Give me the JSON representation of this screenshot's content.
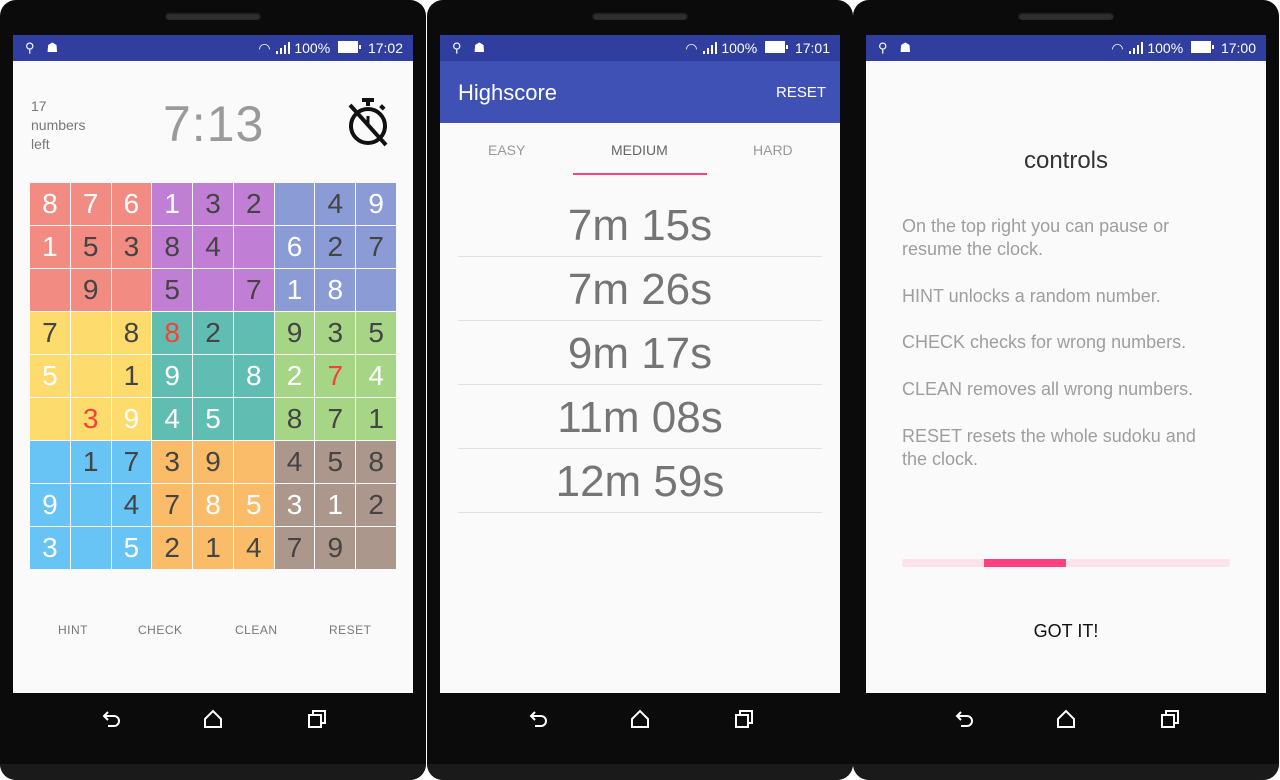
{
  "status_bars": [
    {
      "battery": "100%",
      "time": "17:02"
    },
    {
      "battery": "100%",
      "time": "17:01"
    },
    {
      "battery": "100%",
      "time": "17:00"
    }
  ],
  "game": {
    "numbers_left": "17",
    "numbers_left_line2": "numbers",
    "numbers_left_line3": "left",
    "timer": "7:13",
    "actions": {
      "hint": "HINT",
      "check": "CHECK",
      "clean": "CLEAN",
      "reset": "RESET"
    },
    "box_colors": [
      "#f28b82",
      "#c07fd4",
      "#8b9bd6",
      "#fddb6d",
      "#5fbdb1",
      "#a6d685",
      "#67c4f4",
      "#fbbc6a",
      "#ab978c"
    ],
    "error_color": "#f44336",
    "grid": [
      [
        "8",
        "7",
        "6",
        "1",
        "3",
        "2",
        "",
        "4",
        "9"
      ],
      [
        "1",
        "5",
        "3",
        "8",
        "4",
        "",
        "6",
        "2",
        "7"
      ],
      [
        "",
        "9",
        "",
        "5",
        "",
        "7",
        "1",
        "8",
        ""
      ],
      [
        "7",
        "",
        "8",
        "8",
        "2",
        "",
        "9",
        "3",
        "5"
      ],
      [
        "5",
        "",
        "1",
        "9",
        "",
        "8",
        "2",
        "7",
        "4"
      ],
      [
        "",
        "3",
        "9",
        "4",
        "5",
        "",
        "8",
        "7",
        "1"
      ],
      [
        "",
        "1",
        "7",
        "3",
        "9",
        "",
        "4",
        "5",
        "8"
      ],
      [
        "9",
        "",
        "4",
        "7",
        "8",
        "5",
        "3",
        "1",
        "2"
      ],
      [
        "3",
        "",
        "5",
        "2",
        "1",
        "4",
        "7",
        "9",
        ""
      ]
    ],
    "light_cells": [
      [
        0,
        0
      ],
      [
        0,
        1
      ],
      [
        0,
        2
      ],
      [
        0,
        3
      ],
      [
        0,
        8
      ],
      [
        1,
        0
      ],
      [
        1,
        6
      ],
      [
        2,
        6
      ],
      [
        2,
        7
      ],
      [
        4,
        0
      ],
      [
        4,
        3
      ],
      [
        4,
        5
      ],
      [
        4,
        6
      ],
      [
        4,
        8
      ],
      [
        5,
        2
      ],
      [
        5,
        3
      ],
      [
        5,
        4
      ],
      [
        7,
        0
      ],
      [
        7,
        4
      ],
      [
        7,
        5
      ],
      [
        7,
        6
      ],
      [
        7,
        7
      ],
      [
        8,
        0
      ],
      [
        8,
        2
      ]
    ],
    "error_cells": [
      [
        3,
        3
      ],
      [
        4,
        7
      ],
      [
        5,
        1
      ]
    ]
  },
  "highscore": {
    "title": "Highscore",
    "reset": "RESET",
    "tabs": [
      "EASY",
      "MEDIUM",
      "HARD"
    ],
    "active_tab": "MEDIUM",
    "scores": [
      "7m 15s",
      "7m 26s",
      "9m 17s",
      "11m 08s",
      "12m 59s"
    ]
  },
  "controls": {
    "title": "controls",
    "paragraphs": [
      "On the top right you can pause or resume the clock.",
      "HINT unlocks a random number.",
      "CHECK checks for wrong numbers.",
      "CLEAN removes all wrong numbers.",
      "RESET resets the whole sudoku and the clock."
    ],
    "progress": {
      "segment": 2,
      "of": 4
    },
    "got_it": "GOT IT!"
  }
}
